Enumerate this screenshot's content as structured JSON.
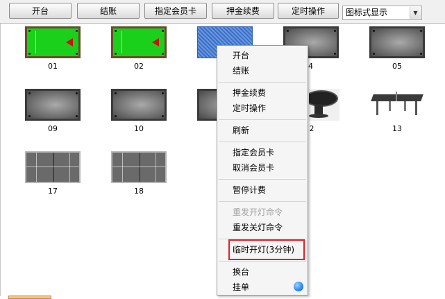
{
  "toolbar": {
    "buttons": [
      "开台",
      "结账",
      "指定会员卡",
      "押金续费",
      "定时操作"
    ],
    "view_mode": "图标式显示"
  },
  "tables": [
    {
      "number": "01",
      "type": "billiards",
      "status": "in-use"
    },
    {
      "number": "02",
      "type": "billiards",
      "status": "in-use"
    },
    {
      "number": "",
      "type": "billiards",
      "status": "selected"
    },
    {
      "number": "04",
      "type": "billiards",
      "status": "idle"
    },
    {
      "number": "05",
      "type": "billiards",
      "status": "idle"
    },
    {
      "number": "09",
      "type": "billiards",
      "status": "idle"
    },
    {
      "number": "10",
      "type": "billiards",
      "status": "idle"
    },
    {
      "number": "2",
      "type": "round-table",
      "status": "idle"
    },
    {
      "number": "13",
      "type": "ping-pong",
      "status": "idle"
    },
    {
      "number": "17",
      "type": "court",
      "status": "idle"
    },
    {
      "number": "18",
      "type": "court",
      "status": "idle"
    }
  ],
  "context_menu": {
    "items": [
      {
        "label": "开台",
        "enabled": true
      },
      {
        "label": "结账",
        "enabled": true
      },
      {
        "label": "押金续费",
        "enabled": true
      },
      {
        "label": "定时操作",
        "enabled": true
      },
      {
        "label": "刷新",
        "enabled": true
      },
      {
        "label": "指定会员卡",
        "enabled": true
      },
      {
        "label": "取消会员卡",
        "enabled": true
      },
      {
        "label": "暂停计费",
        "enabled": true
      },
      {
        "label": "重发开灯命令",
        "enabled": false
      },
      {
        "label": "重发关灯命令",
        "enabled": true
      },
      {
        "label": "临时开灯(3分钟)",
        "enabled": true,
        "highlighted": true
      },
      {
        "label": "换台",
        "enabled": true
      },
      {
        "label": "挂单",
        "enabled": true
      }
    ]
  },
  "colors": {
    "in_use_felt": "#1bd01b",
    "idle_felt": "#707070",
    "selected": "#3a6fc9",
    "highlight_box": "#e0202a",
    "status_orb": "#2f8ff0"
  },
  "icons": [
    "dropdown-arrow-icon",
    "billiard-table-icon",
    "round-table-icon",
    "ping-pong-table-icon",
    "court-icon",
    "status-orb-icon"
  ]
}
